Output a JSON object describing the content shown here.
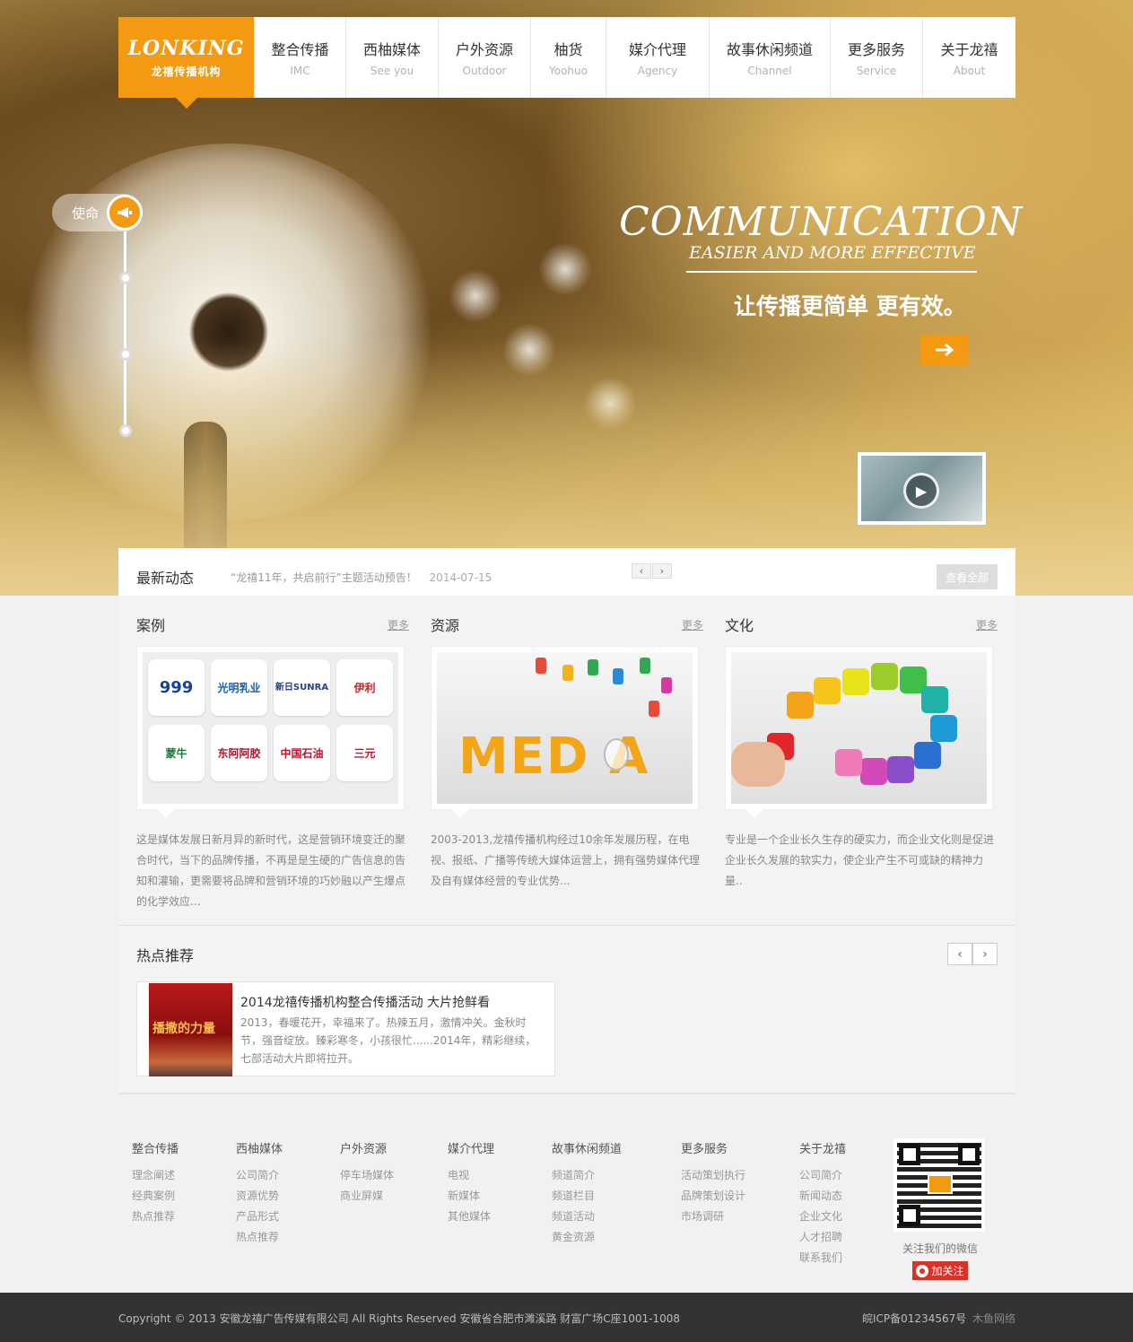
{
  "brand": {
    "logo_mark": "LONKING",
    "logo_sub": "龙禧传播机构",
    "accent": "#f39a12"
  },
  "nav": {
    "items": [
      {
        "cn": "整合传播",
        "en": "IMC"
      },
      {
        "cn": "西柚媒体",
        "en": "See you"
      },
      {
        "cn": "户外资源",
        "en": "Outdoor"
      },
      {
        "cn": "柚货",
        "en": "Yoohuo"
      },
      {
        "cn": "媒介代理",
        "en": "Agency"
      },
      {
        "cn": "故事休闲频道",
        "en": "Channel"
      },
      {
        "cn": "更多服务",
        "en": "Service"
      },
      {
        "cn": "关于龙禧",
        "en": "About"
      }
    ]
  },
  "hero": {
    "mission_label": "使命",
    "mission_icon": "megaphone-icon",
    "slogan_big": "COMMUNICATION",
    "slogan_sub": "EASIER AND MORE EFFECTIVE",
    "slogan_cn": "让传播更简单 更有效。",
    "arrow_icon": "arrow-right-icon",
    "play_icon": "play-icon"
  },
  "news": {
    "title": "最新动态",
    "item_text": "“龙禧11年，共启前行”主题活动预告！",
    "item_date": "2014-07-15",
    "prev": "‹",
    "next": "›",
    "view_all": "查看全部"
  },
  "sections": {
    "more_label": "更多",
    "cases": {
      "title": "案例",
      "logos": [
        "999",
        "光明乳业",
        "新日SUNRA",
        "伊利",
        "蒙牛",
        "东阿阿胶",
        "中国石油",
        "三元"
      ],
      "desc": "这是媒体发展日新月异的新时代，这是营销环境变迁的聚合时代，当下的品牌传播，不再是是生硬的广告信息的告知和灌输，更需要将品牌和营销环境的巧妙融以产生爆点的化学效应..."
    },
    "resources": {
      "title": "资源",
      "media_word": "MED A",
      "desc": "2003-2013,龙禧传播机构经过10余年发展历程，在电视、报纸、广播等传统大媒体运营上，拥有强势媒体代理及自有媒体经营的专业优势..."
    },
    "culture": {
      "title": "文化",
      "desc": "专业是一个企业长久生存的硬实力，而企业文化则是促进企业长久发展的软实力，使企业产生不可或缺的精神力量.."
    }
  },
  "hot": {
    "title": "热点推荐",
    "prev": "‹",
    "next": "›",
    "card_title": "2014龙禧传播机构整合传播活动 大片抢鲜看",
    "card_img_text": "播撒的力量",
    "card_desc": "2013，春暖花开，幸福来了。热辣五月，激情冲关。金秋时节，强音绽放。臻彩寒冬，小孩很忙......2014年，精彩继续，七部活动大片即将拉开。"
  },
  "footer": {
    "cols": [
      {
        "head": "整合传播",
        "links": [
          "理念阐述",
          "经典案例",
          "热点推荐"
        ]
      },
      {
        "head": "西柚媒体",
        "links": [
          "公司简介",
          "资源优势",
          "产品形式",
          "热点推荐"
        ]
      },
      {
        "head": "户外资源",
        "links": [
          "停车场媒体",
          "商业屏媒"
        ]
      },
      {
        "head": "媒介代理",
        "links": [
          "电视",
          "新媒体",
          "其他媒体"
        ]
      },
      {
        "head": "故事休闲频道",
        "links": [
          "频道简介",
          "频道栏目",
          "频道活动",
          "黄金资源"
        ]
      },
      {
        "head": "更多服务",
        "links": [
          "活动策划执行",
          "品牌策划设计",
          "市场调研"
        ]
      },
      {
        "head": "关于龙禧",
        "links": [
          "公司简介",
          "新闻动态",
          "企业文化",
          "人才招聘",
          "联系我们"
        ]
      }
    ],
    "qr_caption": "关注我们的微信",
    "follow_label": "加关注",
    "copyright": "Copyright © 2013 安徽龙禧广告传媒有限公司  All Rights Reserved  安徽省合肥市濉溪路  财富广场C座1001-1008",
    "icp": "皖ICP备01234567号",
    "maker": "木鱼网络"
  }
}
